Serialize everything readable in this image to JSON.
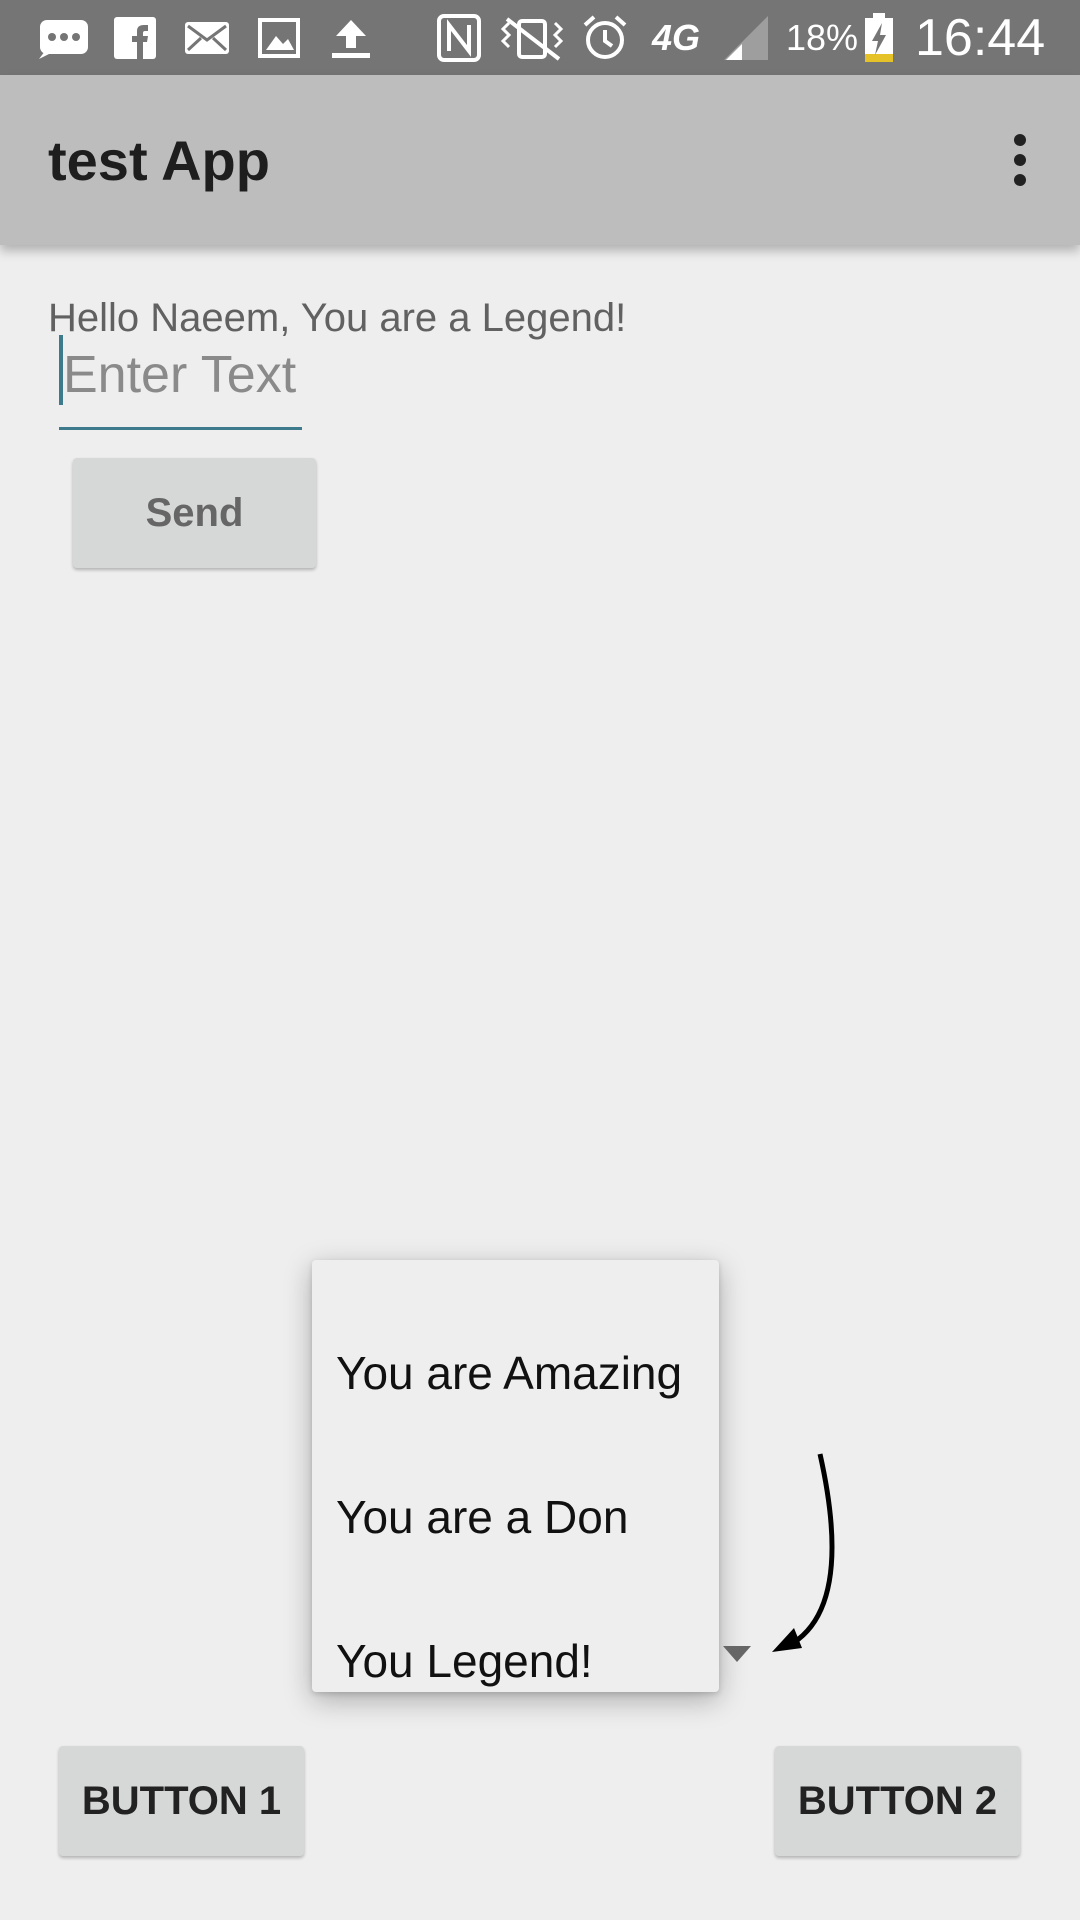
{
  "status_bar": {
    "battery_percent": "18%",
    "time": "16:44",
    "network": "4G",
    "icons": [
      "message-icon",
      "facebook-icon",
      "mail-icon",
      "image-icon",
      "upload-icon",
      "nfc-icon",
      "vibrate-icon",
      "alarm-icon",
      "signal-icon",
      "battery-icon"
    ]
  },
  "app_bar": {
    "title": "test App",
    "menu_icon": "more-vert-icon"
  },
  "main": {
    "greeting": "Hello Naeem, You are a Legend!",
    "input_placeholder": "Enter Text",
    "input_value": "",
    "send_label": "Send"
  },
  "dropdown": {
    "options": [
      "You are Amazing",
      "You are a Don",
      "You Legend!"
    ]
  },
  "buttons": {
    "button1_label": "BUTTON 1",
    "button2_label": "BUTTON 2"
  }
}
